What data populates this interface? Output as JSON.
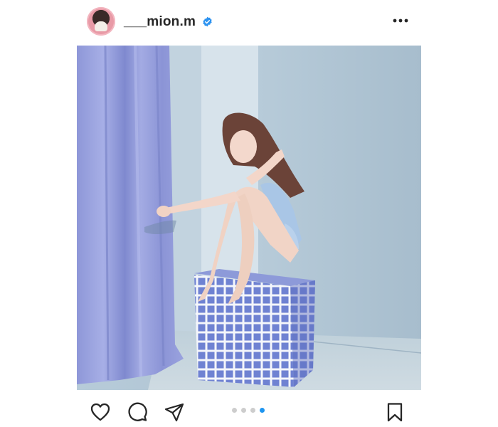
{
  "post": {
    "username": "___mion.m",
    "verified": true,
    "avatar_icon": "profile-avatar",
    "more_icon": "more-options-icon"
  },
  "carousel": {
    "total": 4,
    "current": 4,
    "active_color": "#1e95f0",
    "inactive_color": "#cdcdcd"
  },
  "actions": {
    "like_icon": "heart-icon",
    "comment_icon": "comment-icon",
    "share_icon": "share-icon",
    "save_icon": "bookmark-icon"
  }
}
